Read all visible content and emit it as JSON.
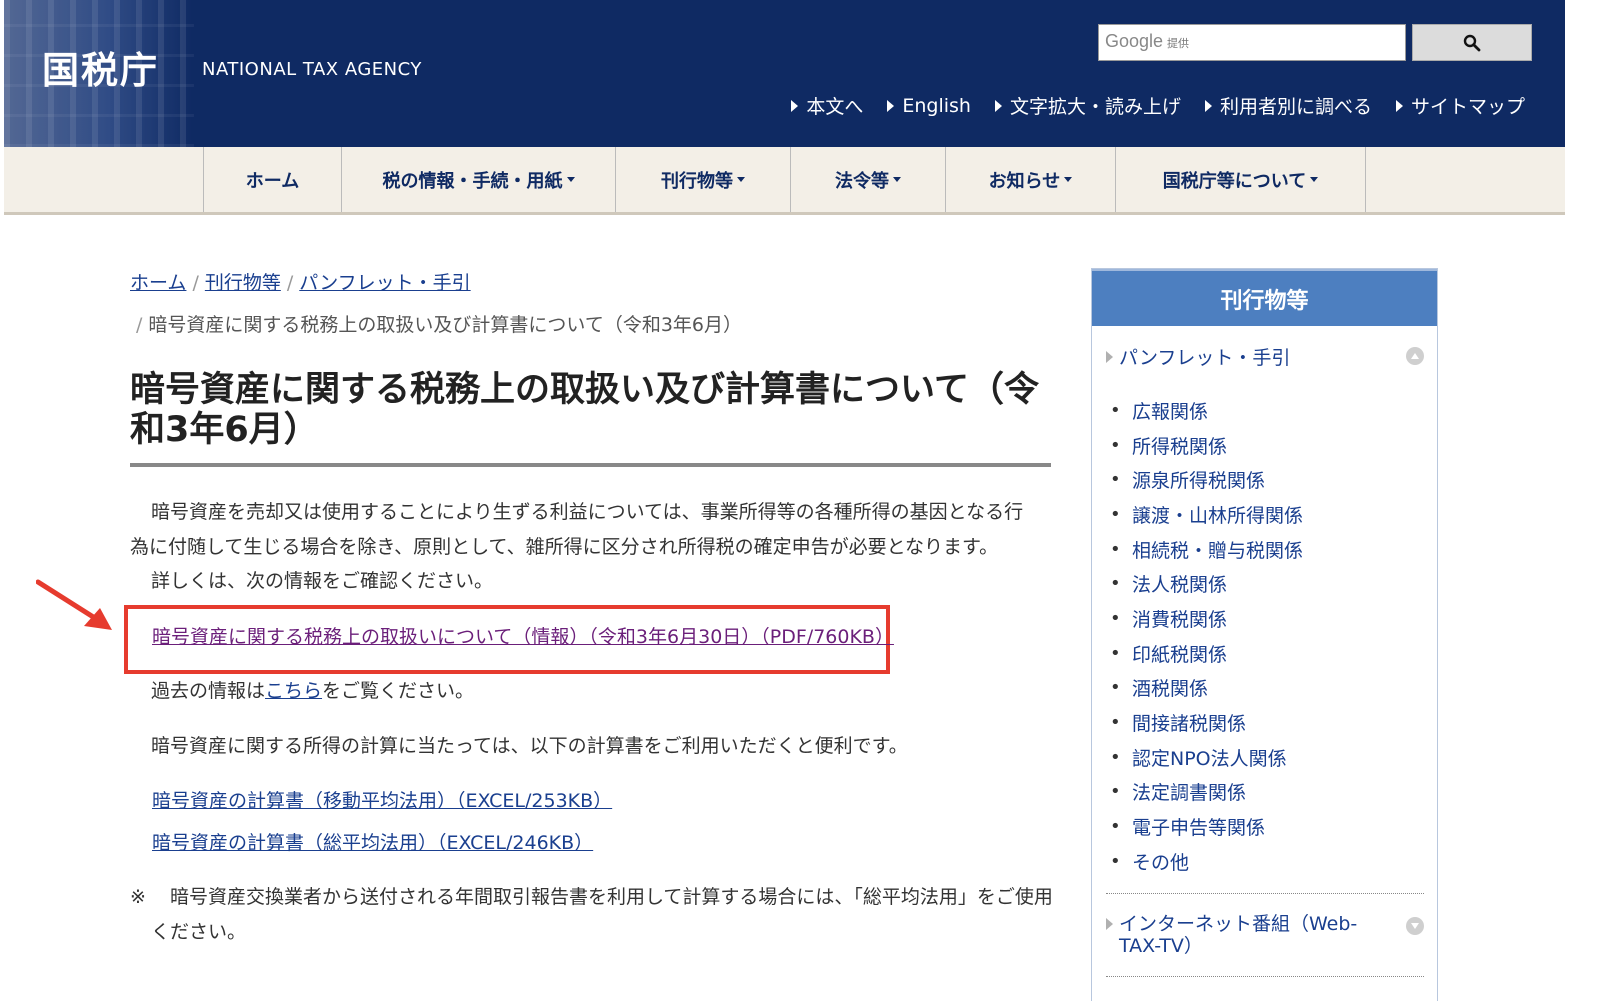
{
  "header": {
    "logo": "国税庁",
    "logo_en": "NATIONAL TAX AGENCY",
    "search_brand": "Google",
    "search_brand_sub": "提供",
    "search_value": "",
    "util_links": [
      "本文へ",
      "English",
      "文字拡大・読み上げ",
      "利用者別に調べる",
      "サイトマップ"
    ]
  },
  "nav": {
    "items": [
      {
        "label": "ホーム",
        "width": 138
      },
      {
        "label": "税の情報・手続・用紙",
        "width": 274
      },
      {
        "label": "刊行物等",
        "width": 175
      },
      {
        "label": "法令等",
        "width": 155
      },
      {
        "label": "お知らせ",
        "width": 170
      },
      {
        "label": "国税庁等について",
        "width": 250
      }
    ]
  },
  "breadcrumb": {
    "home": "ホーム",
    "publications": "刊行物等",
    "pamphlets": "パンフレット・手引",
    "separator": "/",
    "current": "暗号資産に関する税務上の取扱い及び計算書について（令和3年6月）"
  },
  "main": {
    "title": "暗号資産に関する税務上の取扱い及び計算書について（令和3年6月）",
    "intro": "暗号資産を売却又は使用することにより生ずる利益については、事業所得等の各種所得の基因となる行為に付随して生じる場合を除き、原則として、雑所得に区分され所得税の確定申告が必要となります。",
    "details_text": "詳しくは、次の情報をご確認ください。",
    "info_link": "暗号資産に関する税務上の取扱いについて（情報）（令和3年6月30日）（PDF/760KB）",
    "past_prefix": "過去の情報は",
    "past_link": "こちら",
    "past_suffix": "をご覧ください。",
    "calc_text": "暗号資産に関する所得の計算に当たっては、以下の計算書をご利用いただくと便利です。",
    "calc_link_1": "暗号資産の計算書（移動平均法用）（EXCEL/253KB）",
    "calc_link_2": "暗号資産の計算書（総平均法用）（EXCEL/246KB）",
    "note_mark": "※",
    "note_text": "暗号資産交換業者から送付される年間取引報告書を利用して計算する場合には、「総平均法用」をご使用ください。"
  },
  "sidebar": {
    "title": "刊行物等",
    "group1_title": "パンフレット・手引",
    "items": [
      "広報関係",
      "所得税関係",
      "源泉所得税関係",
      "譲渡・山林所得関係",
      "相続税・贈与税関係",
      "法人税関係",
      "消費税関係",
      "印紙税関係",
      "酒税関係",
      "間接諸税関係",
      "認定NPO法人関係",
      "法定調書関係",
      "電子申告等関係",
      "その他"
    ],
    "group2_title": "インターネット番組（Web-TAX-TV）"
  },
  "colors": {
    "header_bg": "#0f2a63",
    "sidebar_head": "#4d7fc0",
    "highlight": "#e63b2e",
    "link": "#1a3f8f"
  }
}
